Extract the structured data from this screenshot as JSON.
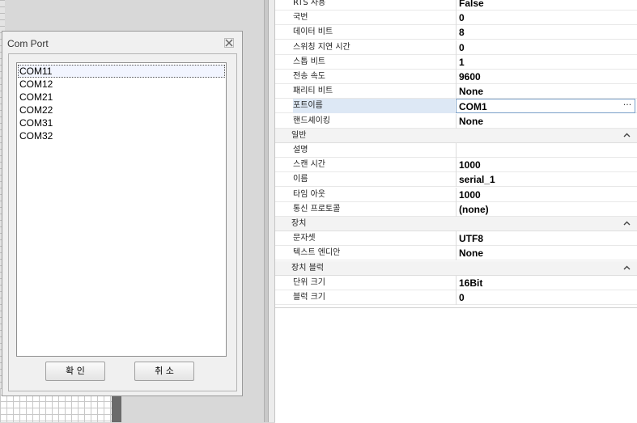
{
  "dialog": {
    "title": "Com Port",
    "close_icon": "close-icon",
    "ports": [
      "COM11",
      "COM12",
      "COM21",
      "COM22",
      "COM31",
      "COM32"
    ],
    "selected_port": "COM11",
    "ok_label": "확 인",
    "cancel_label": "취 소"
  },
  "properties": {
    "rows_top": [
      {
        "name": "RTS 사용",
        "value": "False"
      },
      {
        "name": "국번",
        "value": "0"
      },
      {
        "name": "데이터 비트",
        "value": "8"
      },
      {
        "name": "스위칭 지연 시간",
        "value": "0"
      },
      {
        "name": "스톱 비트",
        "value": "1"
      },
      {
        "name": "전송 속도",
        "value": "9600"
      },
      {
        "name": "패리티 비트",
        "value": "None"
      },
      {
        "name": "포트이름",
        "value": "COM1"
      },
      {
        "name": "핸드셰이킹",
        "value": "None"
      }
    ],
    "category_general": "일반",
    "rows_general": [
      {
        "name": "설명",
        "value": ""
      },
      {
        "name": "스캔 시간",
        "value": "1000"
      },
      {
        "name": "이름",
        "value": "serial_1"
      },
      {
        "name": "타임 아웃",
        "value": "1000"
      },
      {
        "name": "통신 프로토콜",
        "value": "(none)"
      }
    ],
    "category_device": "장치",
    "rows_device": [
      {
        "name": "문자셋",
        "value": "UTF8"
      },
      {
        "name": "텍스트 엔디안",
        "value": "None"
      }
    ],
    "category_block": "장치 블럭",
    "rows_block": [
      {
        "name": "단위 크기",
        "value": "16Bit"
      },
      {
        "name": "블럭 크기",
        "value": "0"
      }
    ],
    "active_ellipsis": "···",
    "collapse_glyph": "^"
  }
}
